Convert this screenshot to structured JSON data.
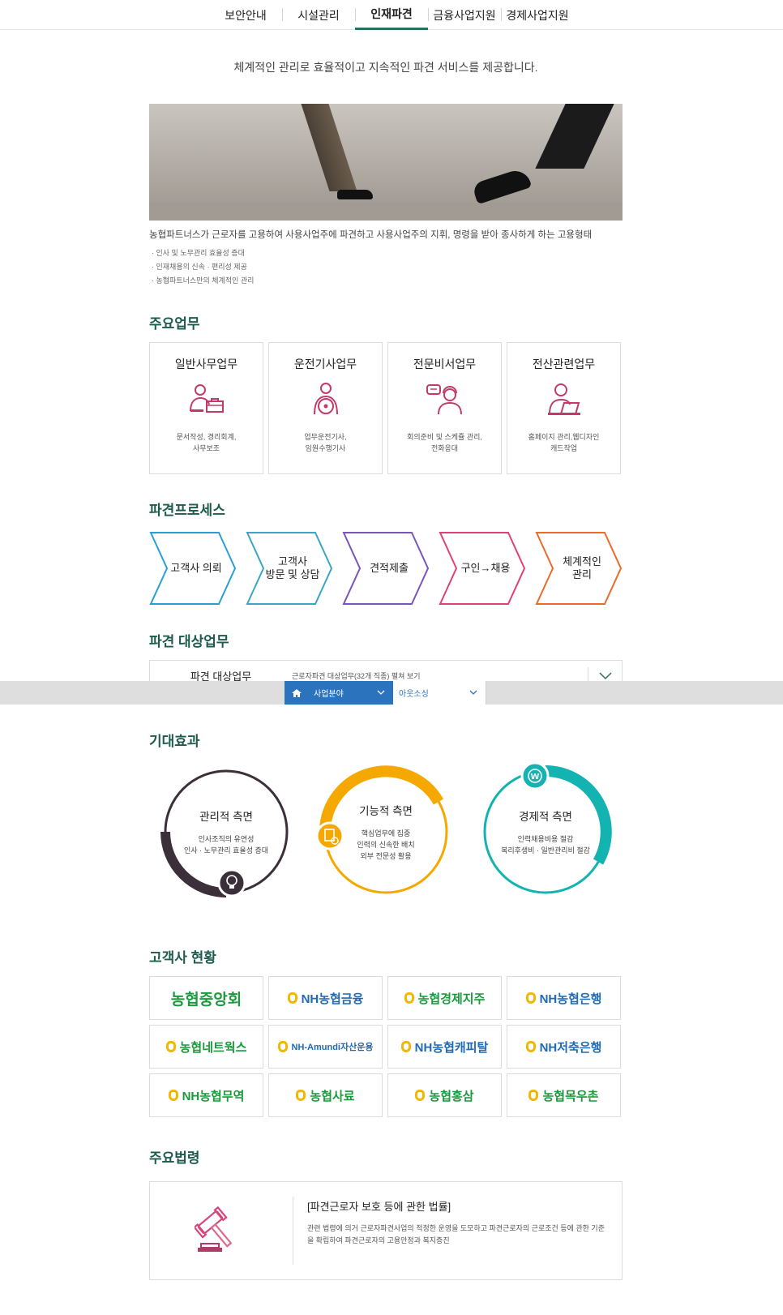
{
  "topnav": {
    "tabs": [
      {
        "label": "보안안내"
      },
      {
        "label": "시설관리"
      },
      {
        "label": "인재파견"
      },
      {
        "label": "금융사업지원"
      },
      {
        "label": "경제사업지원"
      }
    ],
    "active_index": 2
  },
  "intro": "체계적인 관리로 효율적이고 지속적인 파견 서비스를 제공합니다.",
  "description": "농협파트너스가 근로자를 고용하여 사용사업주에 파견하고 사용사업주의 지휘, 명령을 받아 종사하게 하는 고용형태",
  "bullets": [
    "· 인사 및 노무관리 효율성 증대",
    "· 인재채용의 신속 · 편리성 제공",
    "· 농협파트너스만의 체계적인 관리"
  ],
  "main_duties": {
    "title": "주요업무",
    "cards": [
      {
        "title": "일반사무업무",
        "icon": "office-worker-icon",
        "lines": [
          "문서작성, 경리회계,",
          "사무보조"
        ]
      },
      {
        "title": "운전기사업무",
        "icon": "driver-icon",
        "lines": [
          "업무운전기사,",
          "임원수행기사"
        ]
      },
      {
        "title": "전문비서업무",
        "icon": "secretary-headset-icon",
        "lines": [
          "회의준비 및 스케쥴 관리,",
          "전화응대"
        ]
      },
      {
        "title": "전산관련업무",
        "icon": "computer-worker-icon",
        "lines": [
          "홈페이지 관리,웹디자인",
          "캐드작업"
        ]
      }
    ]
  },
  "process": {
    "title": "파견프로세스",
    "steps": [
      {
        "lines": [
          "고객사 의뢰"
        ],
        "color": "#2a9fd6"
      },
      {
        "lines": [
          "고객사",
          "방문 및 상담"
        ],
        "color": "#3aa6c4"
      },
      {
        "lines": [
          "견적제출"
        ],
        "color": "#7a55b8"
      },
      {
        "lines": [
          "구인→채용"
        ],
        "color": "#e0407a"
      },
      {
        "lines": [
          "체계적인",
          "관리"
        ],
        "color": "#ee6a2a"
      }
    ]
  },
  "target_duties": {
    "title": "파견 대상업무",
    "label": "파견 대상업무",
    "value": "근로자파견 대상업무(32개 직종) 펼쳐 보기"
  },
  "sticky_bar": {
    "primary": "사업분야",
    "secondary": "아웃소싱"
  },
  "effects": {
    "title": "기대효과",
    "items": [
      {
        "title": "관리적 측면",
        "lines": [
          "인사조직의 유연성",
          "인사 · 노무관리 효율성 증대"
        ],
        "color": "#3b2f3a",
        "icon": "lightbulb-icon"
      },
      {
        "title": "기능적 측면",
        "lines": [
          "핵심업무에 집중",
          "인력의 신속한 배치",
          "외부 전문성 활용"
        ],
        "color": "#f5a800",
        "icon": "document-icon"
      },
      {
        "title": "경제적 측면",
        "lines": [
          "인력채용비용 절감",
          "복리후생비 · 일반관리비 절감"
        ],
        "color": "#12b3b0",
        "icon": "won-coin-icon"
      }
    ]
  },
  "clients": {
    "title": "고객사 현황",
    "logos": [
      {
        "text": "농협중앙회",
        "color": "#1a9a3c"
      },
      {
        "text": "NH농협금융",
        "color": "#1f6ab5"
      },
      {
        "text": "농협경제지주",
        "color": "#1a9a3c"
      },
      {
        "text": "NH농협은행",
        "color": "#1f6ab5"
      },
      {
        "text": "농협네트웍스",
        "color": "#1a9a3c"
      },
      {
        "text": "NH-Amundi자산운용",
        "color": "#1f6ab5"
      },
      {
        "text": "NH농협캐피탈",
        "color": "#1f6ab5"
      },
      {
        "text": "NH저축은행",
        "color": "#1f6ab5"
      },
      {
        "text": "NH농협무역",
        "color": "#1a9a3c"
      },
      {
        "text": "농협사료",
        "color": "#1a9a3c"
      },
      {
        "text": "농협홍삼",
        "color": "#1a9a3c"
      },
      {
        "text": "농협목우촌",
        "color": "#1a9a3c"
      }
    ]
  },
  "law": {
    "title": "주요법령",
    "heading": "[파견근로자 보호 등에 관한 법률]",
    "body": "관련 법령에 의거 근로자파견사업의 적정한 운영을 도모하고 파견근로자의 근로조건 등에 관한 기준을 확립하여 파견근로자의 고용안정과 복지증진"
  }
}
